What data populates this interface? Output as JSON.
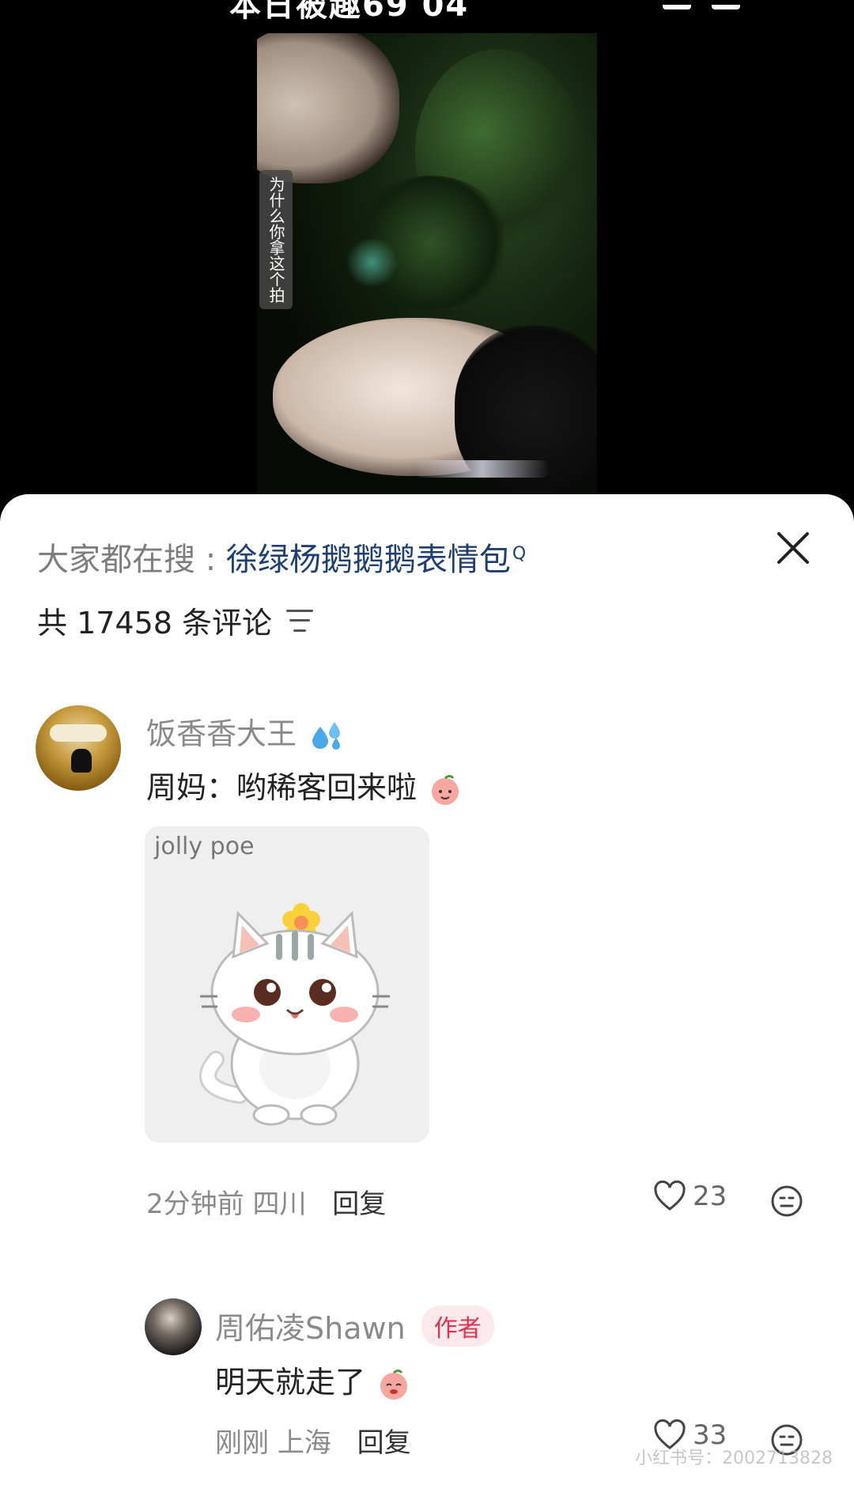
{
  "status_bar": {
    "partial_text": "本日被趣69 04"
  },
  "video": {
    "caption": "为什么你拿这个拍"
  },
  "comments_panel": {
    "hot_search_prefix": "大家都在搜 : ",
    "hot_search_term": "徐绿杨鹅鹅鹅表情包",
    "hot_search_superscript": "Q",
    "total_label": "共 17458 条评论"
  },
  "comment_1": {
    "username": "饭香香大王",
    "text": "周妈：哟稀客回来啦",
    "sticker_brand": "jolly poe",
    "time": "2分钟前",
    "location": "四川",
    "reply_label": "回复",
    "likes": "23"
  },
  "comment_2": {
    "username": "周佑凌Shawn",
    "author_badge": "作者",
    "text": "明天就走了",
    "time": "刚刚",
    "location": "上海",
    "reply_label": "回复",
    "likes": "33"
  },
  "watermark": "小红书号：2002713828",
  "colors": {
    "search_term": "#1f3f73",
    "author_badge_bg": "#fde9ec",
    "author_badge_text": "#e0324f"
  }
}
